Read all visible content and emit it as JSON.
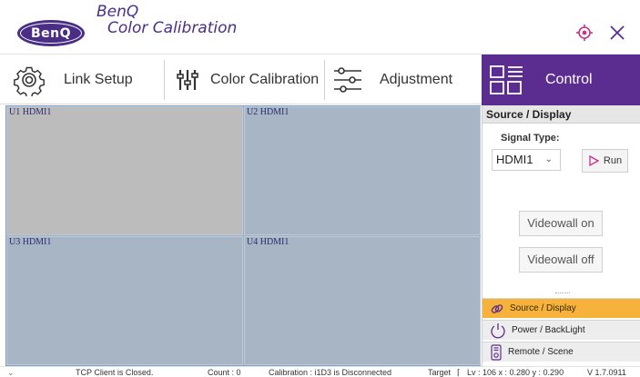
{
  "header": {
    "logo_text": "BenQ",
    "title_line1": "BenQ",
    "title_line2": "Color Calibration",
    "accent_color": "#5c2d91"
  },
  "tabs": [
    {
      "label": "Link Setup",
      "icon": "gear-icon"
    },
    {
      "label": "Color Calibration",
      "icon": "sliders-icon"
    },
    {
      "label": "Adjustment",
      "icon": "adjust-sliders-icon"
    },
    {
      "label": "Control",
      "icon": "grid-control-icon",
      "active": true
    }
  ],
  "displays": [
    {
      "label": "U1 HDMI1",
      "selected": true
    },
    {
      "label": "U2 HDMI1"
    },
    {
      "label": "U3 HDMI1"
    },
    {
      "label": "U4 HDMI1"
    }
  ],
  "panel": {
    "header": "Source / Display",
    "signal_type_label": "Signal Type:",
    "signal_type_value": "HDMI1",
    "run_label": "Run",
    "videowall_on": "Videowall on",
    "videowall_off": "Videowall off",
    "nav": [
      {
        "label": "Source / Display",
        "active": true,
        "icon": "link-icon"
      },
      {
        "label": "Power / BackLight",
        "icon": "power-icon"
      },
      {
        "label": "Remote / Scene",
        "icon": "remote-icon"
      }
    ]
  },
  "status": {
    "tcp": "TCP Client  is Closed.",
    "count": "Count : 0",
    "calibration": "Calibration : i1D3 is Disconnected",
    "target": "Target",
    "lv": "Lv : 106  x : 0.280  y : 0.290",
    "version": "V 1.7.0911"
  }
}
